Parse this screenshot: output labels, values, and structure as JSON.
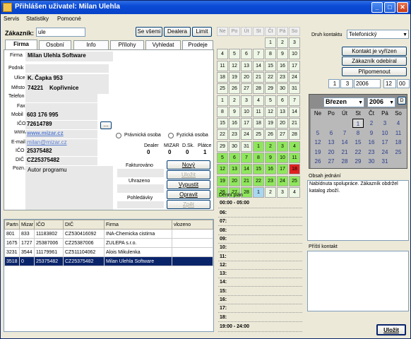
{
  "title": "Přihlášen uživatel: Milan Ulehla",
  "menu": [
    "Servis",
    "Statistiky",
    "Pomocné"
  ],
  "customer": {
    "label": "Zákazník:",
    "value": "ule"
  },
  "top_buttons": {
    "all": "Se všemi",
    "dealer": "Dealera",
    "limit": "Limit"
  },
  "tabs": [
    "Firma",
    "Osobní",
    "Info",
    "Přílohy",
    "Vyhledat",
    "Prodeje"
  ],
  "firm": {
    "firma_l": "Firma",
    "firma": "Milan Ulehla Software",
    "podnik_l": "Podnik",
    "ulice_l": "Ulice",
    "ulice": "K. Čapka 953",
    "mesto_l": "Město",
    "psc": "74221",
    "mesto": "Kopřivnice",
    "telefon_l": "Telefon",
    "fax_l": "Fax",
    "mobil_l": "Mobil",
    "mobil": "603 176 995",
    "ico_l": "IČO",
    "ico": "72614789",
    "www_l": "WWW",
    "www": "www.mizar.cz",
    "email_l": "E-mail",
    "email": "milan@mizar.cz",
    "ico2_l": "IČO",
    "ico2": "25375482",
    "dic_l": "DIČ",
    "dic": "CZ25375482",
    "pozn_l": "Pozn.",
    "pozn": "Autor programu",
    "dots": "...",
    "legal": "Právnická osoba",
    "natural": "Fyzická osoba",
    "dealer_l": "Dealer",
    "dealer": "0",
    "mizar_l": "MIZAR",
    "mizar": "0",
    "dsk_l": "D.Sk.",
    "dsk": "0",
    "platce_l": "Plátce",
    "platce": "1",
    "fakt_l": "Fakturováno",
    "uhr_l": "Uhrazeno",
    "pohl_l": "Pohledávky"
  },
  "actions": {
    "new": "Nový",
    "save": "Uložit",
    "print": "Vypustit",
    "fix": "Opravit",
    "back": "Zpět"
  },
  "table": {
    "headers": [
      "Partn",
      "Mizar",
      "IČO",
      "DIČ",
      "Firma",
      "vlozeno"
    ],
    "rows": [
      [
        "801",
        "833",
        "11183802",
        "CZ530416092",
        "INA-Chemicka cistirna",
        ""
      ],
      [
        "1675",
        "1727",
        "25387006",
        "CZ25387006",
        "ZULEPA s.r.o.",
        ""
      ],
      [
        "3231",
        "3544",
        "11179961",
        "CZ511104062",
        "Alois Mikulenka",
        ""
      ],
      [
        "3518",
        "0",
        "25375482",
        "CZ25375482",
        "Milan Ulehla Software",
        ""
      ]
    ]
  },
  "calendar": {
    "days": [
      "Ne",
      "Po",
      "Út",
      "St",
      "Čt",
      "Pá",
      "So"
    ],
    "weeks": [
      [
        "",
        "",
        "",
        "",
        "1",
        "2",
        "3"
      ],
      [
        "4",
        "5",
        "6",
        "7",
        "8",
        "9",
        "10"
      ],
      [
        "11",
        "12",
        "13",
        "14",
        "15",
        "16",
        "17"
      ],
      [
        "18",
        "19",
        "20",
        "21",
        "22",
        "23",
        "24"
      ],
      [
        "25",
        "26",
        "27",
        "28",
        "29",
        "30",
        "31"
      ],
      [
        "1",
        "2",
        "3",
        "4",
        "5",
        "6",
        "7"
      ],
      [
        "8",
        "9",
        "10",
        "11",
        "12",
        "13",
        "14"
      ],
      [
        "15",
        "16",
        "17",
        "18",
        "19",
        "20",
        "21"
      ],
      [
        "22",
        "23",
        "24",
        "25",
        "26",
        "27",
        "28"
      ],
      [
        "29",
        "30",
        "31",
        "1",
        "2",
        "3",
        "4"
      ],
      [
        "5",
        "6",
        "7",
        "8",
        "9",
        "10",
        "11"
      ],
      [
        "12",
        "13",
        "14",
        "15",
        "16",
        "17",
        "18"
      ],
      [
        "19",
        "20",
        "21",
        "22",
        "23",
        "24",
        "25"
      ],
      [
        "26",
        "27",
        "28",
        "1",
        "2",
        "3",
        "4"
      ]
    ]
  },
  "schedule": {
    "title": "Denní plán",
    "start": "00:00 - 05:00",
    "hours": [
      "06:",
      "07:",
      "08:",
      "09:",
      "10:",
      "11:",
      "12:",
      "13:",
      "14:",
      "15:",
      "16:",
      "17:",
      "18:"
    ],
    "end": "19:00 - 24:00"
  },
  "contact": {
    "type_l": "Druh kontaktu",
    "type": "Telefonický",
    "not_done": "Kontakt je vyřízen",
    "ordered": "Zákazník odebíral",
    "remind": "Připomenout",
    "date_d": "1",
    "date_m": "3",
    "date_y": "2006",
    "time_h": "12",
    "time_m": "00"
  },
  "cal2": {
    "month": "Březen",
    "year": "2006",
    "btn": "D",
    "days": [
      "Ne",
      "Po",
      "Út",
      "St",
      "Čt",
      "Pá",
      "So"
    ],
    "weeks": [
      [
        "",
        "",
        "",
        "1",
        "2",
        "3",
        "4"
      ],
      [
        "5",
        "6",
        "7",
        "8",
        "9",
        "10",
        "11"
      ],
      [
        "12",
        "13",
        "14",
        "15",
        "16",
        "17",
        "18"
      ],
      [
        "19",
        "20",
        "21",
        "22",
        "23",
        "24",
        "25"
      ],
      [
        "26",
        "27",
        "28",
        "29",
        "30",
        "31",
        ""
      ]
    ]
  },
  "notes": {
    "obsah_l": "Obsah jednání",
    "obsah": "Nabídnuta spolupráce. Zákazník obdržel katalog zboží.",
    "next_l": "Příští kontakt"
  },
  "save": "Uložit"
}
